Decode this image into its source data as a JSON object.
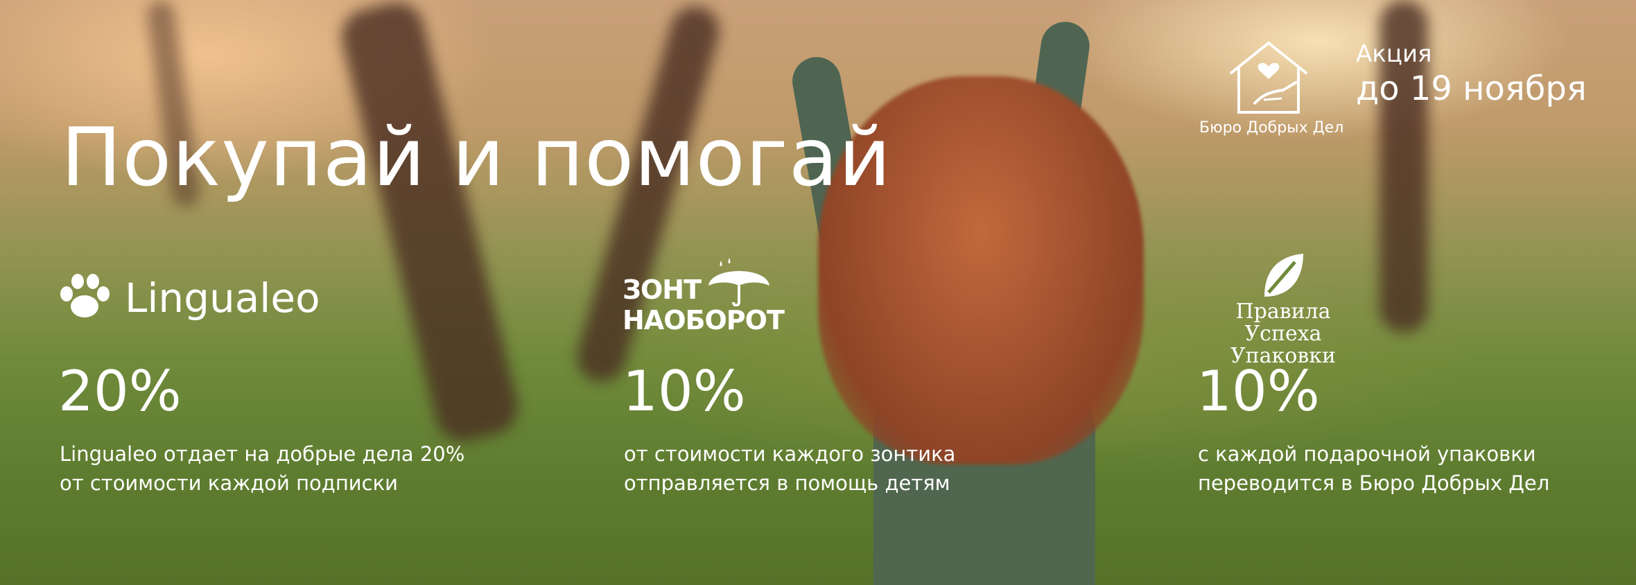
{
  "title": "Покупай и помогай",
  "promo": {
    "label": "Акция",
    "date": "до 19 ноября"
  },
  "bureau": {
    "name": "Бюро Добрых Дел",
    "icon": "house-heart-hand-icon"
  },
  "partners": [
    {
      "name": "Lingualeo",
      "icon": "paw-icon",
      "percent": "20%",
      "desc_line1": "Lingualeo отдает на добрые дела 20%",
      "desc_line2": "от стоимости каждой подписки"
    },
    {
      "logo_line1": "ЗОНТ",
      "logo_line2": "НАОБОРОТ",
      "icon": "umbrella-icon",
      "percent": "10%",
      "desc_line1": "от стоимости каждого зонтика",
      "desc_line2": "отправляется в помощь детям"
    },
    {
      "logo_line1": "Правила Успеха",
      "logo_line2": "Упаковки",
      "icon": "leaf-icon",
      "percent": "10%",
      "desc_line1": "с каждой подарочной упаковки",
      "desc_line2": "переводится в Бюро Добрых Дел"
    }
  ]
}
